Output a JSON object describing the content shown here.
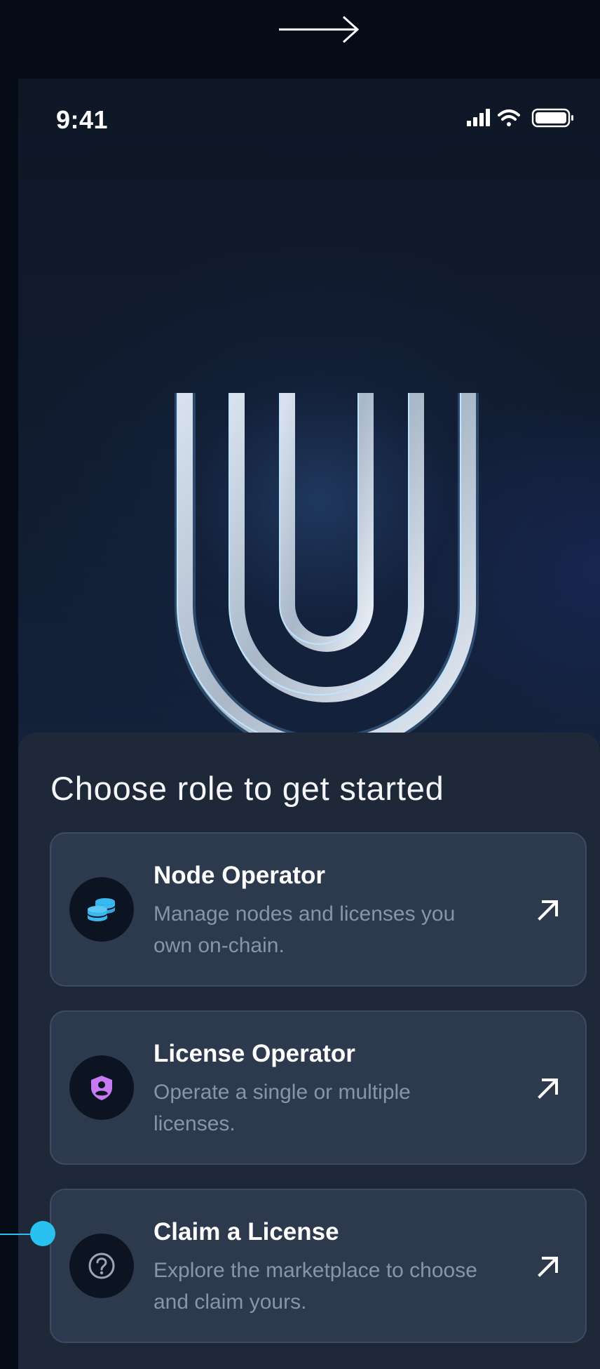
{
  "status_bar": {
    "time": "9:41"
  },
  "sheet": {
    "title": "Choose role to get started",
    "roles": [
      {
        "title": "Node Operator",
        "description": "Manage nodes and licenses you own on-chain.",
        "icon": "coins-stack-icon",
        "icon_color": "#3ab8f0"
      },
      {
        "title": "License Operator",
        "description": "Operate a single or multiple licenses.",
        "icon": "shield-user-icon",
        "icon_color": "#c77bf2"
      },
      {
        "title": "Claim a License",
        "description": "Explore the marketplace to choose and claim yours.",
        "icon": "question-circle-icon",
        "icon_color": "#9aa5b8"
      }
    ]
  },
  "colors": {
    "background": "#050b17",
    "sheet": "#1e2838",
    "card": "#2d3a4e",
    "accent": "#29c2f0"
  }
}
